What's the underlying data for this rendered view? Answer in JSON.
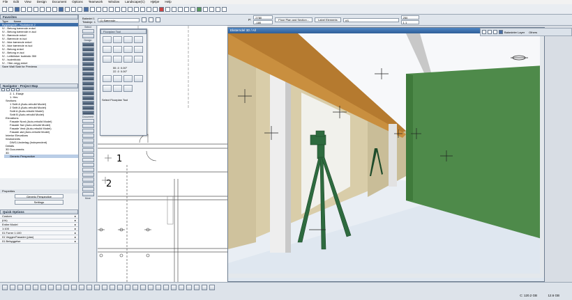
{
  "menu": [
    "File",
    "Edit",
    "View",
    "Design",
    "Document",
    "Options",
    "Teamwork",
    "Window",
    "Landscape(C)",
    "Hjelpe",
    "Help"
  ],
  "infobox": {
    "layer_label": "Bakedel 1",
    "layer_label2": "Tidslinje: 1",
    "layer_value": "(1) Bærende...",
    "p_label": "P:",
    "p_value1": "2780",
    "p_value2": "-180",
    "floorplan_button": "Floor Plan and Section...",
    "label_elements": "Label Elements",
    "vis_value": "VS",
    "num1": "250",
    "num2": "1 1"
  },
  "properties_panel": {
    "title": "Favorites",
    "header_type": "Type",
    "header_name": "Name",
    "items": [
      "Bygningsdel - Radiatorvk 2",
      "IV - Betong bærende enkel",
      "IV - Betong bærende m.isol",
      "IV - Bærende enkel",
      "IV - Bærende m.isol",
      "IV - Ikke bærende enkel",
      "IV - Ikke bærende m.isol",
      "IV - Betong enkel",
      "IV - Betong m.isol",
      "IV - Lettklinker Isoblokk 350",
      "IV - Isolerblokk",
      "IV - Ytter-vegg enkel"
    ],
    "selected_index": 0,
    "footer": "Save Wall Slab for Previews"
  },
  "navigator": {
    "title": "Navigator - Project Map",
    "items": [
      "2. 1. Etasje",
      "1. Hev",
      "Sections",
      "1 Snitt A (Auto-rebuild Model)",
      "2 Snitt A (Auto-rebuild Model)",
      "Snitt A (Auto-rebuild Model)",
      "Snitt B (Auto-rebuild Model)",
      "Elevations",
      "Fasade Nord (Auto-rebuild Model)",
      "Fasade Sør (Auto-rebuild Model)",
      "Fasade Vest (Auto-rebuild Model)",
      "Fasade øst (Auto-rebuild Model)",
      "Interior Elevations",
      "Worksheets",
      "DWG-Underlag (Independent)",
      "Details",
      "3D Documents",
      "3D",
      "Generic Perspective"
    ],
    "selected": "Generic Perspective",
    "properties_label": "Properties",
    "properties_value": "Generic Perspective",
    "settings_button": "Settings"
  },
  "quick_options": {
    "title": "Quick Options",
    "rows": [
      "Custom",
      "(i:ik)",
      "Entire Model",
      "1:100",
      "01 Forrer 1:100",
      "01 Vegger/Fasader (plan)",
      "01 Bebyggelse"
    ]
  },
  "toolbox": {
    "select": "Select",
    "design": "Design",
    "document": "Document",
    "more": "More"
  },
  "floater": {
    "title": "Floorplan Tool",
    "v1": "55 .0",
    "v2": "0.00°",
    "v3": "22 .0",
    "v4": "0.00°",
    "footer": "Select Floorplan Tool"
  },
  "plan": {
    "marker1": "1",
    "marker2": "2"
  },
  "view3d": {
    "title": "Eksterndel 3D / All"
  },
  "right_panel": {
    "title": "Bakedel 1",
    "layers_label": "Bakedeler Layer",
    "others": "Others"
  },
  "status": {
    "disk1": "C: 120.2 GB",
    "disk2": "12.6 GB"
  },
  "colors": {
    "accent": "#2f5f98",
    "wall_green": "#4e8a4a",
    "tripod": "#2e6b3f",
    "beam": "#c98f3f"
  }
}
